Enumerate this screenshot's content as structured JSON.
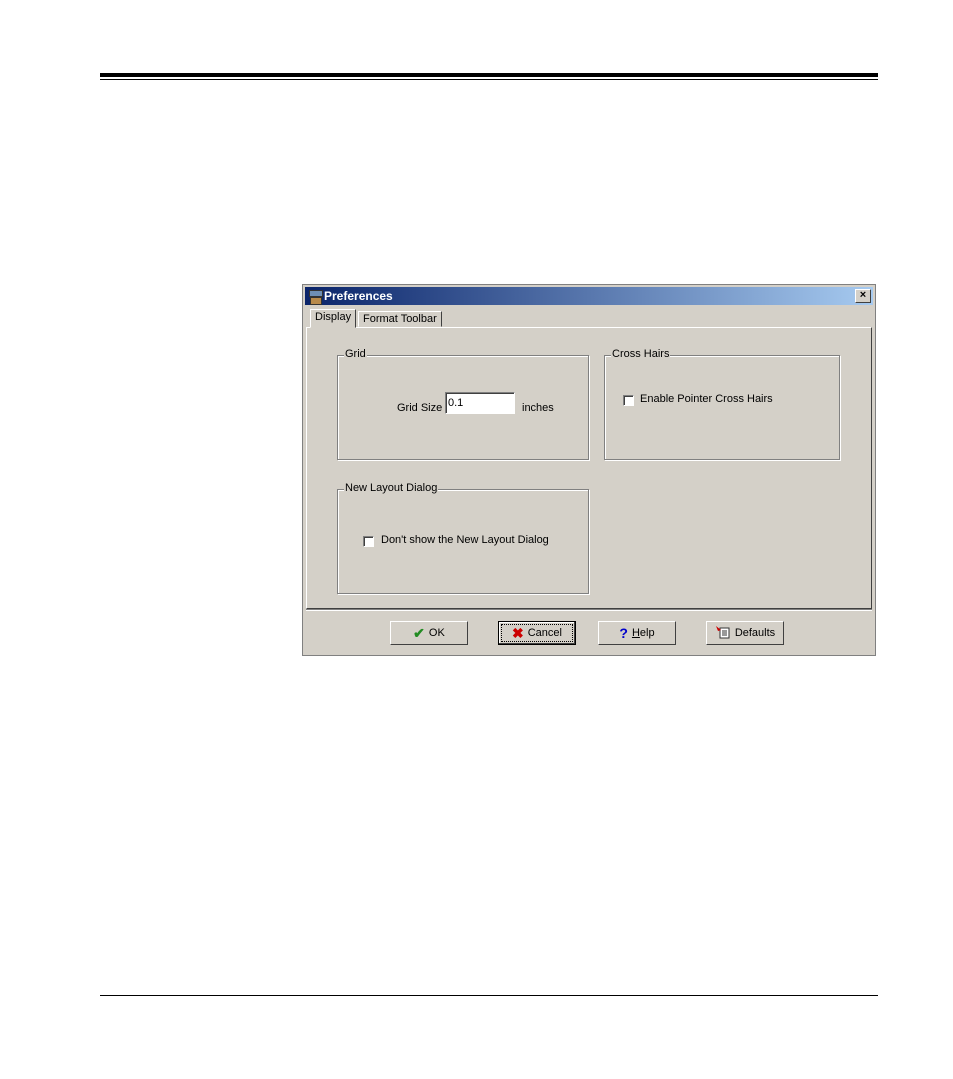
{
  "dialog": {
    "title": "Preferences",
    "close_label": "×",
    "tabs": [
      {
        "label": "Display"
      },
      {
        "label": "Format Toolbar"
      }
    ],
    "grid": {
      "group_title": "Grid",
      "size_label": "Grid Size",
      "size_value": "0.1",
      "unit_label": "inches"
    },
    "cross_hairs": {
      "group_title": "Cross Hairs",
      "checkbox_label": "Enable Pointer Cross Hairs",
      "checked": false
    },
    "new_layout": {
      "group_title": "New Layout Dialog",
      "checkbox_label": "Don't show the New Layout Dialog",
      "checked": false
    },
    "buttons": {
      "ok": "OK",
      "cancel": "Cancel",
      "help": "Help",
      "defaults": "Defaults"
    },
    "icons": {
      "ok": "checkmark-icon",
      "cancel": "x-icon",
      "help": "question-icon",
      "defaults": "defaults-icon"
    },
    "colors": {
      "ok_icon": "#228b22",
      "cancel_icon": "#cc0000",
      "help_icon": "#0000cc"
    }
  }
}
